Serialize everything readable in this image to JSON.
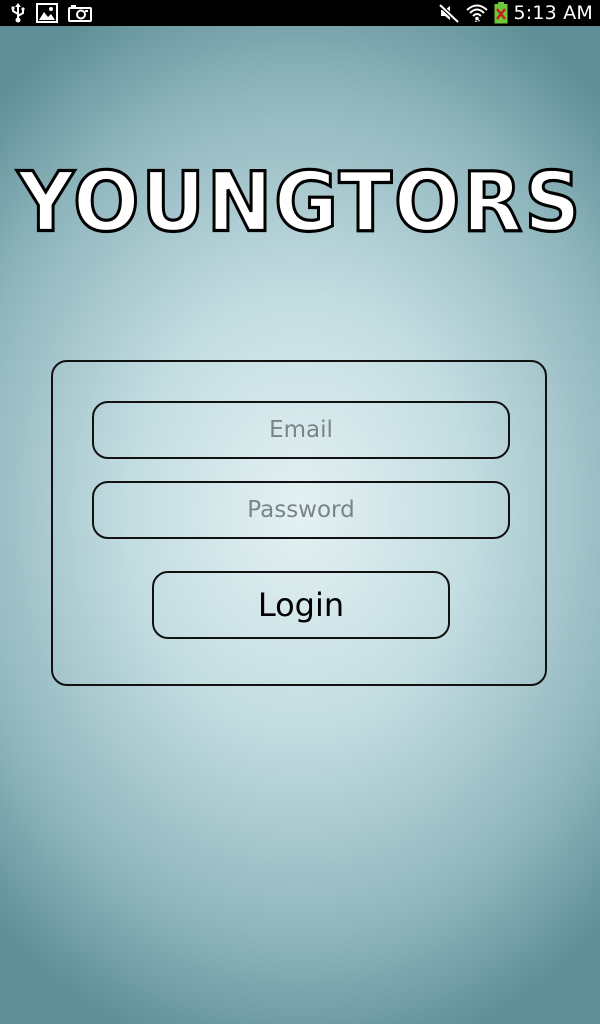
{
  "status_bar": {
    "time": "5:13 AM",
    "left_icons": [
      "usb-icon",
      "image-icon",
      "camera-icon"
    ],
    "right_icons": [
      "mute-icon",
      "wifi-icon",
      "battery-icon"
    ]
  },
  "app": {
    "logo_text": "YOUNGTORS"
  },
  "login_form": {
    "email": {
      "value": "",
      "placeholder": "Email"
    },
    "password": {
      "value": "",
      "placeholder": "Password"
    },
    "login_label": "Login"
  },
  "colors": {
    "background_center": "#e4f1f3",
    "background_edge": "#5f8e96",
    "outline": "#111111",
    "placeholder": "#7a8587",
    "status_bar": "#000000"
  }
}
